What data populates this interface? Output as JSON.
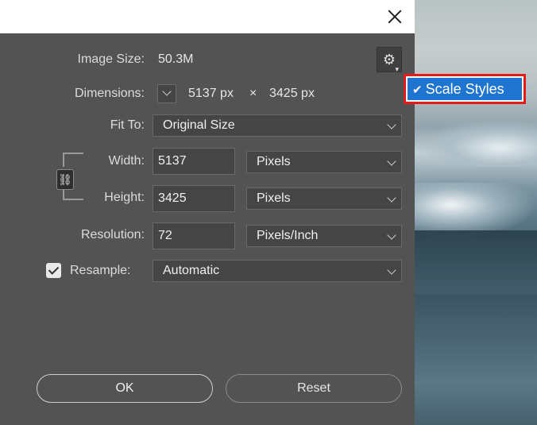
{
  "dialog": {
    "image_size_label": "Image Size:",
    "image_size_value": "50.3M",
    "dimensions_label": "Dimensions:",
    "dimensions_width": "5137 px",
    "dimensions_times": "×",
    "dimensions_height": "3425 px",
    "fit_to_label": "Fit To:",
    "fit_to_value": "Original Size",
    "width_label": "Width:",
    "width_value": "5137",
    "width_unit": "Pixels",
    "height_label": "Height:",
    "height_value": "3425",
    "height_unit": "Pixels",
    "resolution_label": "Resolution:",
    "resolution_value": "72",
    "resolution_unit": "Pixels/Inch",
    "resample_label": "Resample:",
    "resample_value": "Automatic",
    "resample_checked": true
  },
  "menu": {
    "scale_styles_label": "Scale Styles",
    "scale_styles_checked": true
  },
  "buttons": {
    "ok_label": "OK",
    "reset_label": "Reset"
  },
  "icons": {
    "gear": "gear-icon",
    "close": "close-icon",
    "link": "link-icon",
    "chevron": "chevron-down-icon",
    "check": "checkmark-icon"
  }
}
